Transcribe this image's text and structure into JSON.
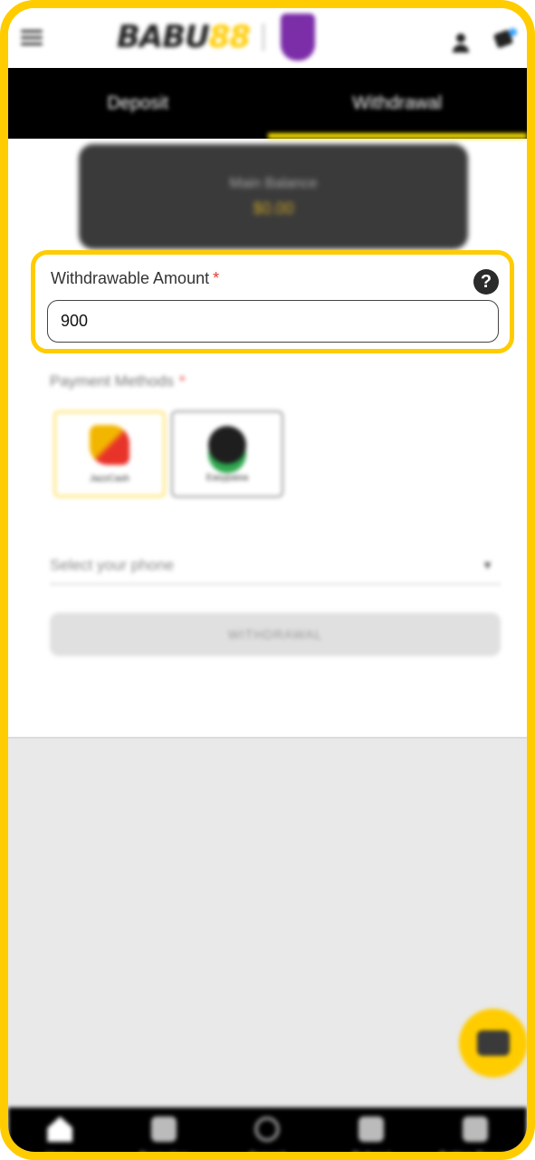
{
  "header": {
    "logo_part1": "BABU",
    "logo_part2": "88"
  },
  "tabs": [
    {
      "label": "Deposit",
      "active": false
    },
    {
      "label": "Withdrawal",
      "active": true
    }
  ],
  "balance": {
    "label": "Main Balance",
    "value": "$0.00"
  },
  "withdrawable": {
    "label": "Withdrawable Amount",
    "required_mark": "*",
    "value": "900",
    "help_icon": "question-circle-icon",
    "help_glyph": "?"
  },
  "payment": {
    "label": "Payment Methods",
    "required_mark": "*",
    "methods": [
      {
        "name": "JazzCash",
        "selected": true
      },
      {
        "name": "Easypaisa",
        "selected": false
      }
    ]
  },
  "phone_select": {
    "placeholder": "Select your phone",
    "chevron_glyph": "▼"
  },
  "withdraw_button": {
    "label": "WITHDRAWAL"
  },
  "bottom_nav": [
    {
      "label": "Home",
      "icon": "home-icon"
    },
    {
      "label": "Promotion",
      "icon": "tag-icon"
    },
    {
      "label": "Deposit",
      "icon": "deposit-icon"
    },
    {
      "label": "Referral",
      "icon": "share-icon"
    },
    {
      "label": "Betting Record",
      "icon": "record-icon"
    }
  ],
  "colors": {
    "accent": "#ffcc00",
    "tab_underline": "#ffe600",
    "required": "#e53935"
  }
}
